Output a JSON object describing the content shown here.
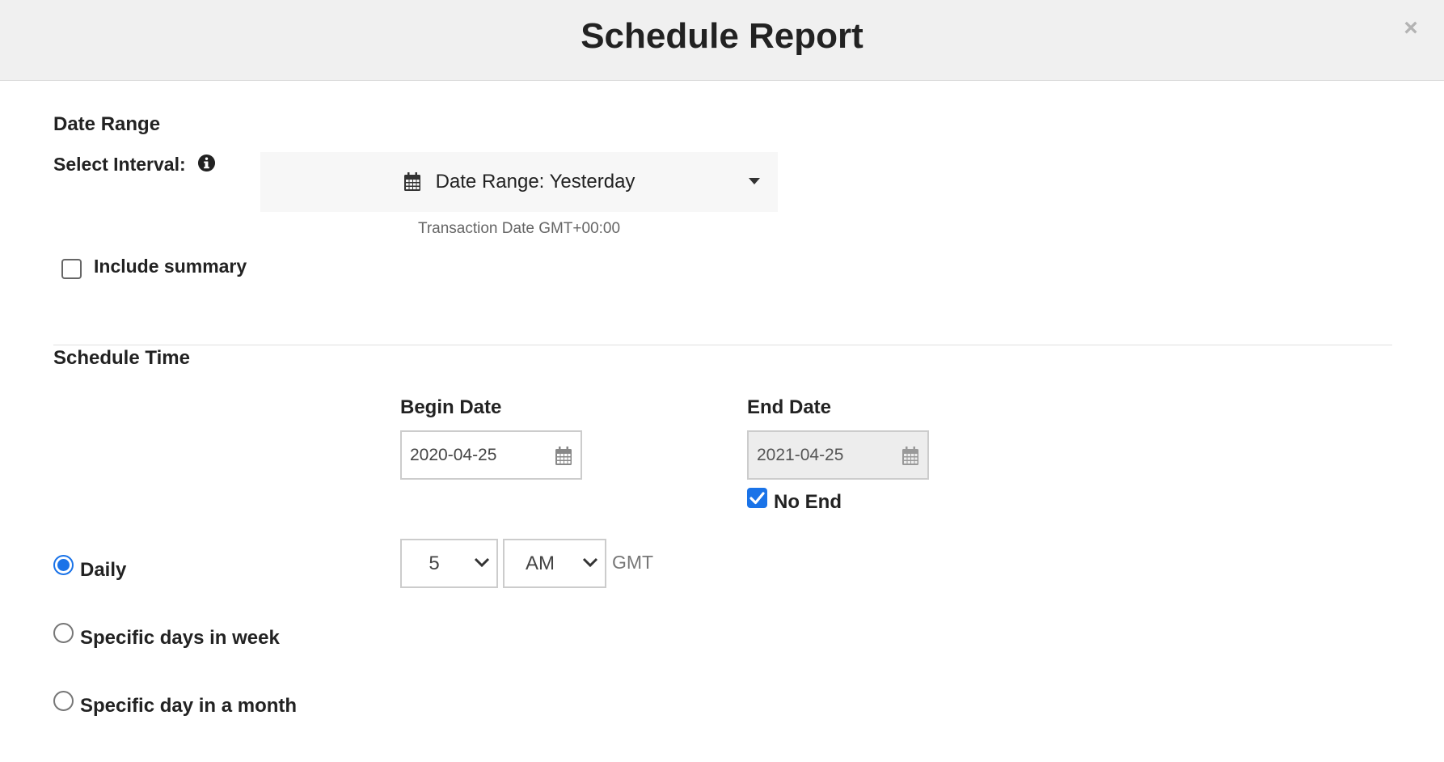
{
  "dialog": {
    "title": "Schedule Report",
    "close_symbol": "×"
  },
  "date_range": {
    "section_title": "Date Range",
    "interval_label": "Select Interval:",
    "interval_value": "Date Range: Yesterday",
    "timezone_note": "Transaction Date GMT+00:00",
    "include_summary_label": "Include summary",
    "include_summary_checked": false
  },
  "schedule": {
    "section_title": "Schedule Time",
    "begin_label": "Begin Date",
    "begin_value": "2020-04-25",
    "end_label": "End Date",
    "end_value": "2021-04-25",
    "no_end_label": "No End",
    "no_end_checked": true,
    "hour_value": "5",
    "ampm_value": "AM",
    "timezone_label": "GMT",
    "frequency_options": [
      {
        "label": "Daily",
        "selected": true
      },
      {
        "label": "Specific days in week",
        "selected": false
      },
      {
        "label": "Specific day in a month",
        "selected": false
      }
    ]
  },
  "icons": {
    "info": "info-circle-icon",
    "calendar": "calendar-icon",
    "caret": "caret-down-icon",
    "chevron": "chevron-down-icon"
  },
  "colors": {
    "accent": "#1a73e8",
    "header_bg": "#f0f0f0",
    "dropdown_bg": "#f7f7f7",
    "disabled_bg": "#ededed"
  }
}
